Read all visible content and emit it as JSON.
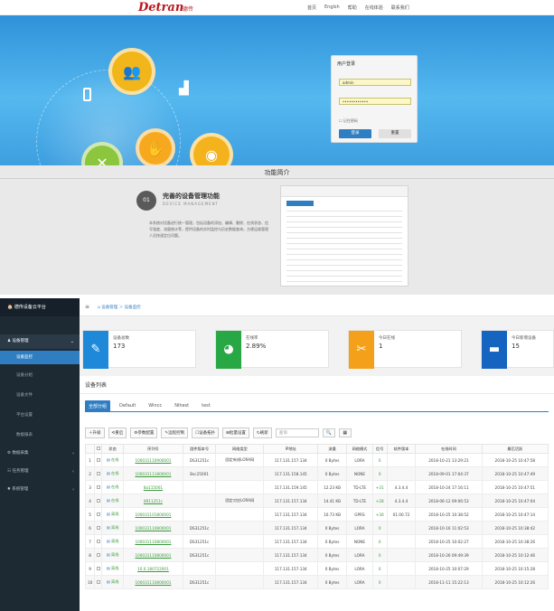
{
  "header": {
    "logo": "Detran",
    "logo_cn": "德传",
    "nav": [
      "首页",
      "Englsh",
      "帮助",
      "在线体验",
      "联系我们"
    ]
  },
  "login": {
    "title": "用户登录",
    "username": "admin",
    "password": "••••••••••••",
    "remember": "记住密码",
    "login_btn": "登录",
    "reset_btn": "重置"
  },
  "features": {
    "section_title": "功能简介",
    "num": "01",
    "heading": "完善的设备管理功能",
    "heading_en": "DEVICE MANAGEMENT",
    "desc": "本系统对设备进行统一管理，包括设备的添加、编辑、删除、在线状态、信号强度、流量统计等，提供设备的实时监控与历史数据查询，方便运维管理人员快速定位问题。"
  },
  "sidebar": {
    "brand": "德传设备云平台",
    "items": [
      {
        "label": "设备管理",
        "arrow": "⌄"
      },
      {
        "label": "设备监控"
      },
      {
        "label": "设备分组"
      },
      {
        "label": "设备文件"
      },
      {
        "label": "平台设置"
      },
      {
        "label": "数据报表"
      },
      {
        "label": "数据采集",
        "arrow": "‹"
      },
      {
        "label": "任务管理",
        "arrow": "‹"
      },
      {
        "label": "系统管理",
        "arrow": "‹"
      }
    ]
  },
  "breadcrumb": {
    "menu_icon": "≡",
    "path": "⌂ 设备管理 ＞ 设备监控"
  },
  "stats": [
    {
      "label": "设备总数",
      "value": "173",
      "color": "#1e88d9",
      "icon": "edit-icon"
    },
    {
      "label": "在线率",
      "value": "2.89%",
      "color": "#27a844",
      "icon": "pie-icon"
    },
    {
      "label": "今日在线",
      "value": "1",
      "color": "#f5a01b",
      "icon": "tools-icon"
    },
    {
      "label": "今日新增设备",
      "value": "15",
      "color": "#1565c0",
      "icon": "disk-icon"
    }
  ],
  "panel": {
    "title": "设备列表",
    "tabs": [
      "全部分组",
      "Default",
      "Wincc",
      "Nihest",
      "test"
    ],
    "toolbar": [
      "＋升级",
      "⟲重启",
      "⚙参数配置",
      "✎远程控制",
      "☐设备拓扑",
      "⊞批量设置",
      "↻刷新"
    ],
    "search_placeholder": "查询",
    "search_icon": "🔍",
    "grid_icon": "▦"
  },
  "table": {
    "headers": [
      "",
      "",
      "状态",
      "序列号",
      "固件版本号",
      "网络类型",
      "IP地址",
      "流量",
      "网络模式",
      "信号",
      "软件版本",
      "在线时间",
      "最后活跃"
    ],
    "rows": [
      [
        "1",
        "在线",
        "100031110900001",
        "DS31251c",
        "固定有线LORA网",
        "117.131.157.134",
        "0 Bytes",
        "LORA",
        "0",
        "",
        "2018-10-21 13:29:21",
        "2018-10-25 10:47:58"
      ],
      [
        "2",
        "在线",
        "100031111800001",
        "Bsc25001",
        "",
        "117.131.158.145",
        "0 Bytes",
        "NONE",
        "0",
        "",
        "2018-09-01 17:04:37",
        "2018-10-25 10:47:49"
      ],
      [
        "3",
        "在线",
        "8a115001",
        "",
        "",
        "117.131.159.145",
        "12.23 KB",
        "TD-LTE",
        "+31",
        "4.3.4.4",
        "2018-10-24 17:16:11",
        "2018-10-25 10:47:51"
      ],
      [
        "4",
        "在线",
        "8911251c",
        "",
        "固定对应LORA网",
        "117.131.157.134",
        "14.41 KB",
        "TD-LTE",
        "+28",
        "4.3.4.4",
        "2018-06-12 09:06:53",
        "2018-10-25 10:47:04"
      ],
      [
        "5",
        "离线",
        "100031101800001",
        "",
        "",
        "117.131.157.134",
        "10.73 KB",
        "GPRS",
        "+30",
        "01.00.72",
        "2018-10-25 10:38:52",
        "2018-10-25 10:47:14"
      ],
      [
        "6",
        "离线",
        "100031110800001",
        "DS31251c",
        "",
        "117.131.157.134",
        "0 Bytes",
        "LORA",
        "0",
        "",
        "2018-10-16 11:02:53",
        "2018-10-25 10:38:42"
      ],
      [
        "7",
        "离线",
        "100031110800001",
        "DS31251c",
        "",
        "117.131.157.134",
        "0 Bytes",
        "NONE",
        "0",
        "",
        "2018-10-25 10:02:27",
        "2018-10-25 10:38:26"
      ],
      [
        "8",
        "离线",
        "100031110800001",
        "DS31251c",
        "",
        "117.131.157.134",
        "0 Bytes",
        "LORA",
        "0",
        "",
        "2018-10-26 09:49:39",
        "2018-10-25 10:12:46"
      ],
      [
        "9",
        "离线",
        "10.0.180722001",
        "",
        "",
        "117.131.157.134",
        "0 Bytes",
        "LORA",
        "0",
        "",
        "2018-10-25 10:07:29",
        "2018-10-25 10:15:28"
      ],
      [
        "10",
        "离线",
        "100031110800001",
        "DS31251c",
        "",
        "117.131.157.134",
        "0 Bytes",
        "LORA",
        "0",
        "",
        "2018-11-11 15:22:13",
        "2018-10-25 10:12:26"
      ]
    ]
  },
  "colors": {
    "primary": "#2f7ec2",
    "sidebar": "#1e2a33",
    "online": "#3a9a3a",
    "hero": "#3a9fe0"
  }
}
